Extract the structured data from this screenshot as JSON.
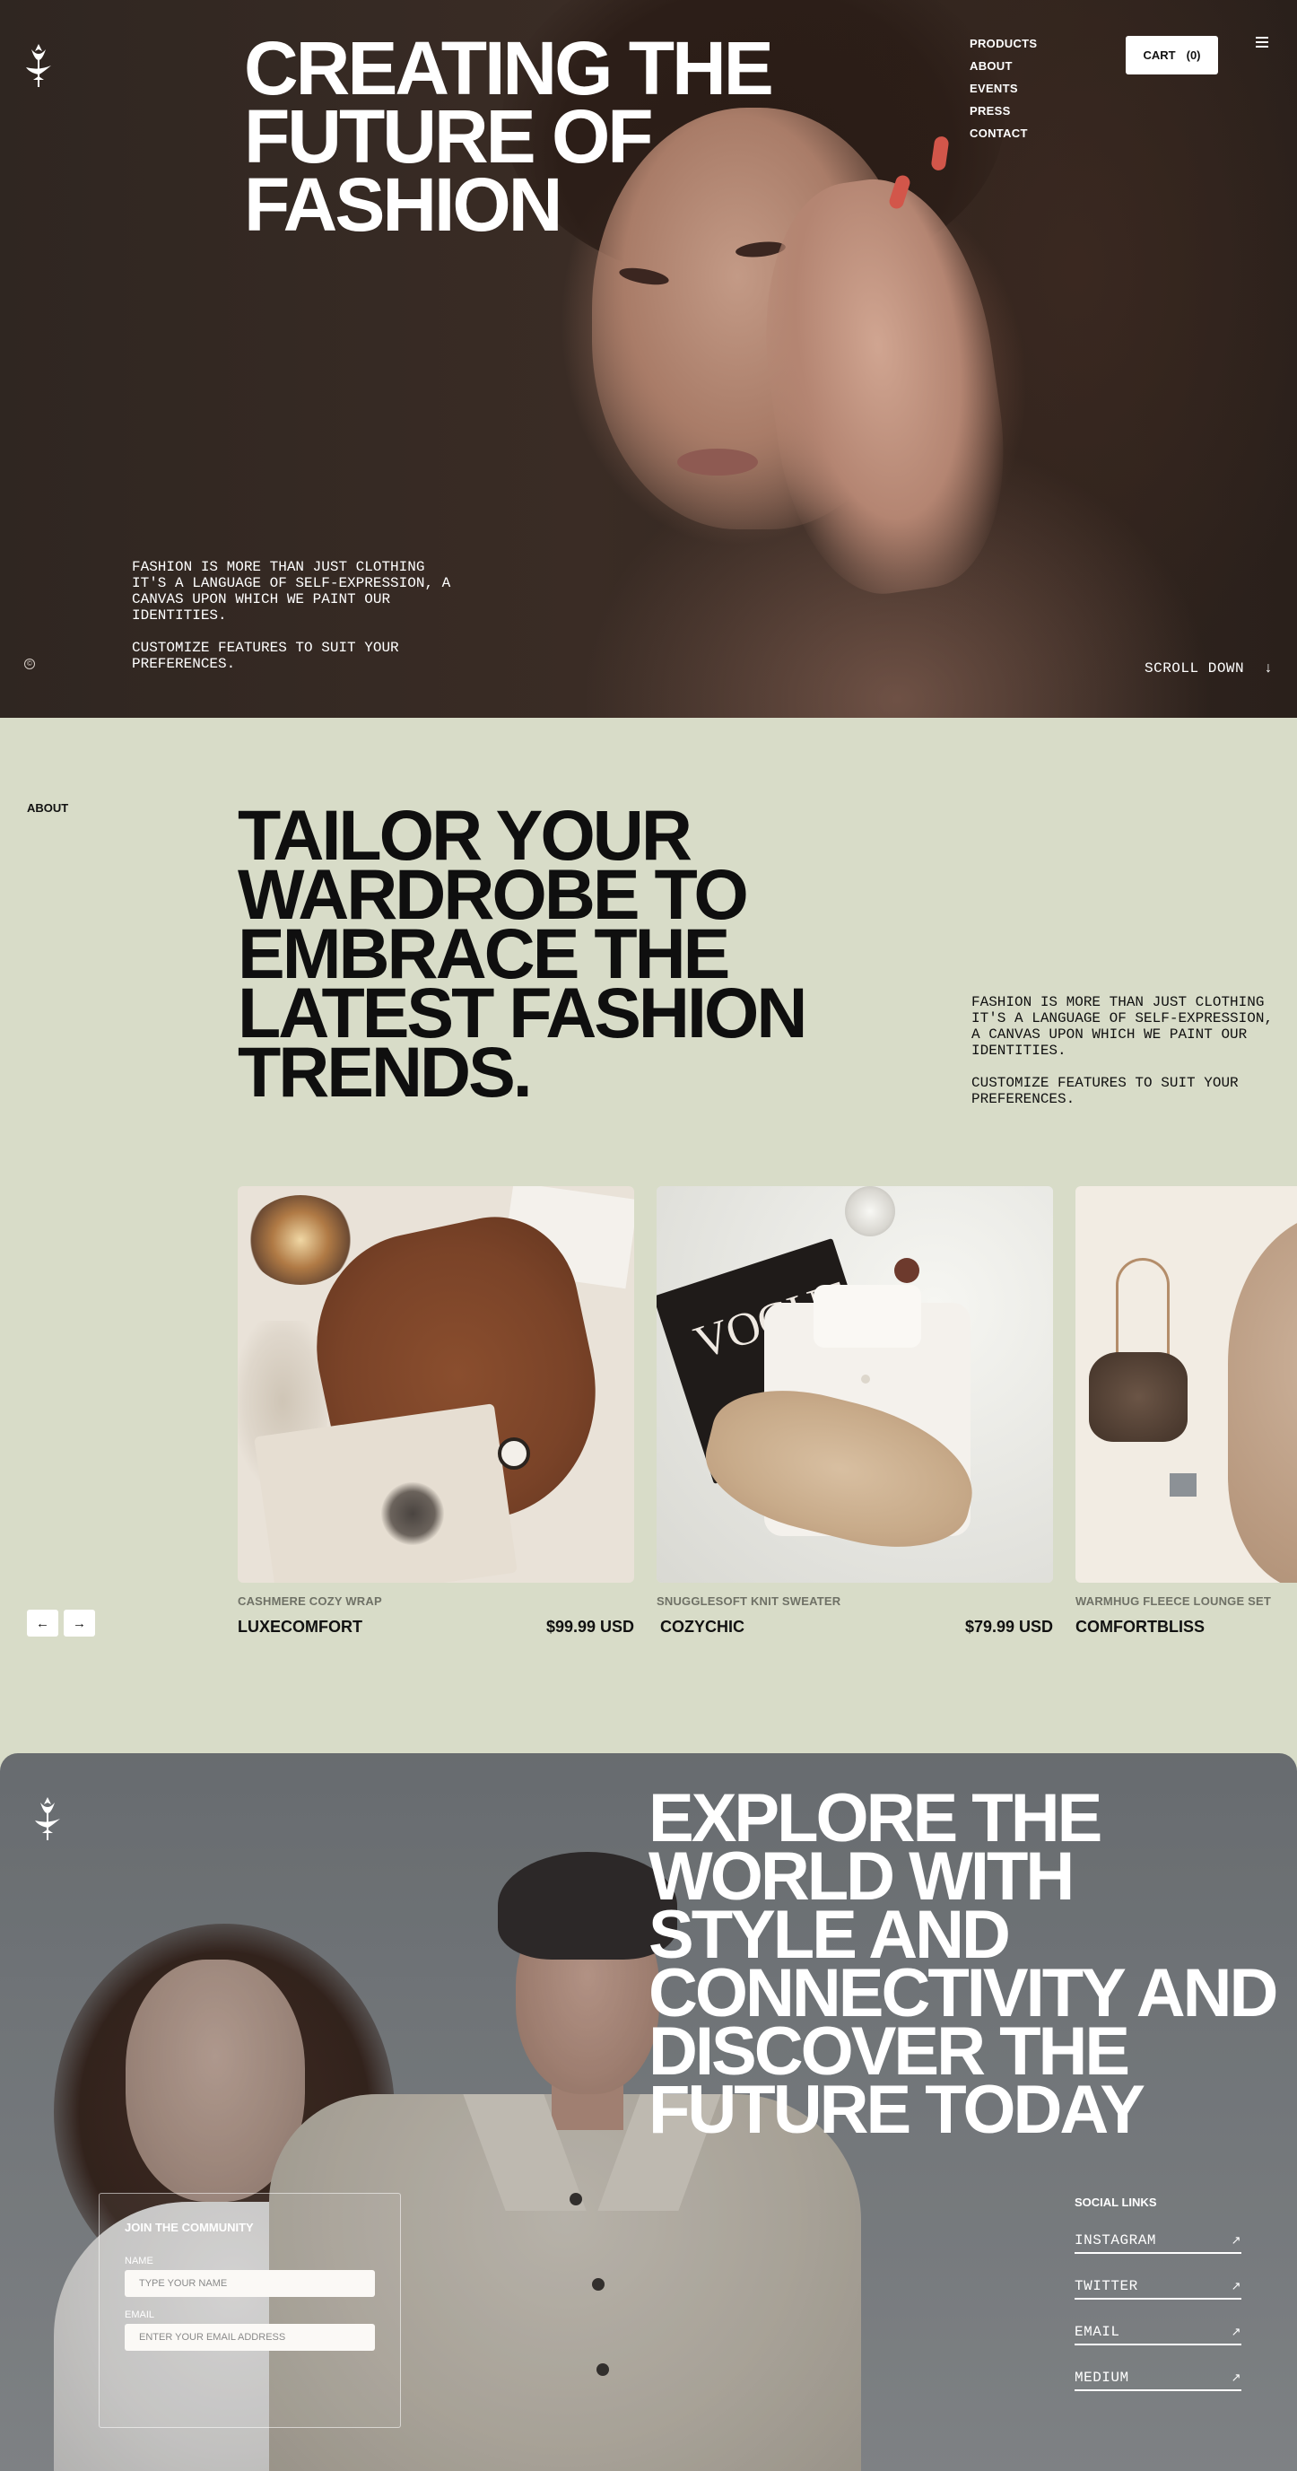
{
  "hero": {
    "title": "CREATING THE FUTURE OF FASHION",
    "nav": [
      "PRODUCTS",
      "ABOUT",
      "EVENTS",
      "PRESS",
      "CONTACT"
    ],
    "cart_label": "CART",
    "cart_count": "(0)",
    "copy_1": "FASHION IS MORE THAN JUST CLOTHING IT'S A LANGUAGE OF SELF-EXPRESSION, A CANVAS UPON WHICH WE PAINT OUR IDENTITIES.",
    "copy_2": "CUSTOMIZE FEATURES TO SUIT YOUR PREFERENCES.",
    "copyright_symbol": "©",
    "scroll_label": "SCROLL DOWN",
    "scroll_arrow": "↓"
  },
  "about": {
    "label": "ABOUT",
    "title": "TAILOR YOUR WARDROBE TO EMBRACE THE LATEST FASHION TRENDS.",
    "copy_1": "FASHION IS MORE THAN JUST CLOTHING IT'S A LANGUAGE OF SELF-EXPRESSION, A CANVAS UPON WHICH WE PAINT OUR IDENTITIES.",
    "copy_2": "CUSTOMIZE FEATURES TO SUIT YOUR PREFERENCES.",
    "products": [
      {
        "subtitle": "CASHMERE COZY WRAP",
        "name": "LUXECOMFORT",
        "price": "$99.99 USD"
      },
      {
        "subtitle": "SNUGGLESOFT KNIT SWEATER",
        "name": "COZYCHIC",
        "price": "$79.99 USD"
      },
      {
        "subtitle": "WARMHUG FLEECE LOUNGE SET",
        "name": "COMFORTBLISS",
        "price": ""
      }
    ],
    "prev_arrow": "←",
    "next_arrow": "→"
  },
  "community": {
    "title": "EXPLORE THE WORLD WITH STYLE AND CONNECTIVITY AND DISCOVER THE FUTURE TODAY",
    "join_title": "JOIN THE COMMUNITY",
    "name_label": "NAME",
    "name_placeholder": "TYPE YOUR NAME",
    "email_label": "EMAIL",
    "email_placeholder": "ENTER YOUR EMAIL ADDRESS",
    "social_title": "SOCIAL LINKS",
    "social_links": [
      "INSTAGRAM",
      "TWITTER",
      "EMAIL",
      "MEDIUM"
    ],
    "link_arrow": "↗"
  },
  "colors": {
    "about_bg": "#d8dcc8",
    "hero_bg": "#33261f",
    "community_bg": "#767b7e"
  },
  "icons": [
    "logo-icon",
    "menu-icon",
    "copyright-icon",
    "arrow-down-icon",
    "arrow-left-icon",
    "arrow-right-icon",
    "arrow-up-right-icon"
  ]
}
